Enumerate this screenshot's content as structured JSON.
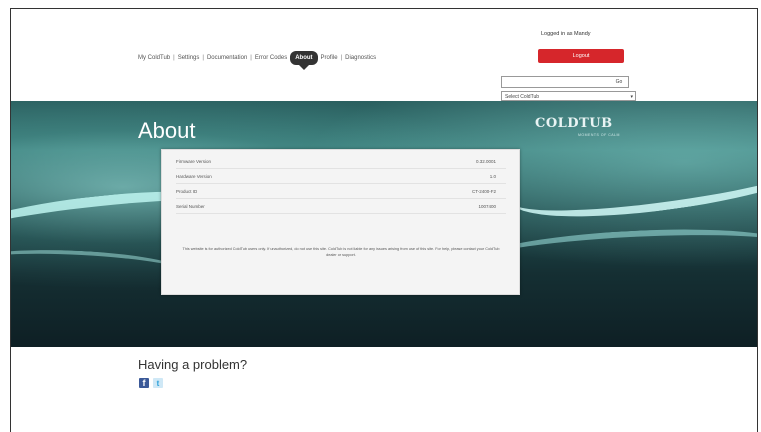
{
  "nav": {
    "items": [
      "My ColdTub",
      "Settings",
      "Documentation",
      "Error Codes",
      "About",
      "Profile",
      "Diagnostics"
    ]
  },
  "account": {
    "logged_in_text": "Logged in as Mandy",
    "logout_label": "Logout",
    "search_button": "Go",
    "select_value": "Select ColdTub"
  },
  "banner": {
    "title": "About",
    "brand": "COLDTUB",
    "brand_sub": "MOMENTS OF CALM"
  },
  "about": {
    "rows": [
      {
        "label": "Firmware Version",
        "value": "0.32.0001"
      },
      {
        "label": "Hardware Version",
        "value": "1.0"
      },
      {
        "label": "Product ID",
        "value": "CT-2400-F2"
      },
      {
        "label": "Serial Number",
        "value": "1007400"
      }
    ],
    "disclaimer": "This website is for authorized ColdTub users only. If unauthorized, do not use this site. ColdTub is not liable for any issues arising from use of this site. For help, please contact your ColdTub dealer or support."
  },
  "footer": {
    "heading": "Having a problem?",
    "facebook_glyph": "f",
    "twitter_glyph": "t"
  }
}
